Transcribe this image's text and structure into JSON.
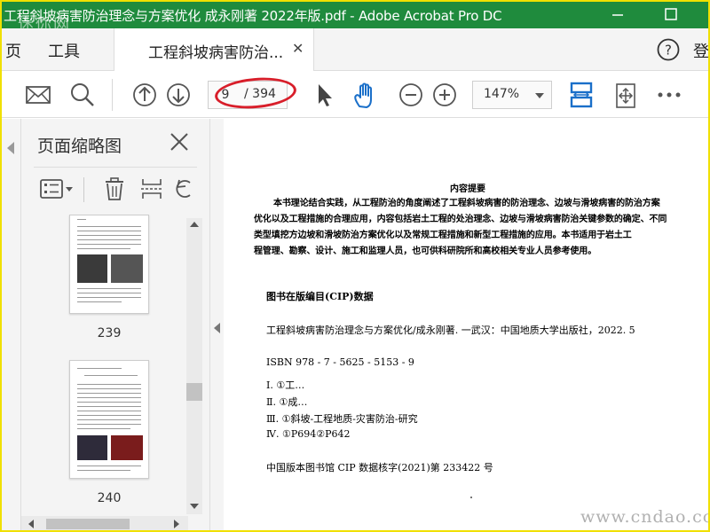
{
  "window": {
    "title": "工程斜坡病害防治理念与方案优化 成永刚著 2022年版.pdf - Adobe Acrobat Pro DC"
  },
  "menubar": {
    "items": [
      "页",
      "工具"
    ],
    "doc_tab_label": "工程斜坡病害防治...",
    "signin_partial": "登"
  },
  "toolbar": {
    "page_current": "9",
    "page_total": "/ 394",
    "zoom": "147%"
  },
  "thumbnails_panel": {
    "title": "页面缩略图",
    "pages": [
      {
        "label": "239"
      },
      {
        "label": "240"
      }
    ]
  },
  "document": {
    "abstract_title": "内容提要",
    "abstract_lines": [
      "本书理论结合实践，从工程防治的角度阐述了工程斜坡病害的防治理念、边坡与滑坡病害的防治方案",
      "优化以及工程措施的合理应用，内容包括岩土工程的处治理念、边坡与滑坡病害防治关键参数的确定、不同",
      "类型填挖方边坡和滑坡防治方案优化以及常规工程措施和新型工程措施的应用。本书适用于岩土工",
      "程管理、勘察、设计、施工和监理人员，也可供科研院所和高校相关专业人员参考使用。"
    ],
    "cip_title": "图书在版编目(CIP)数据",
    "cip_record": "工程斜坡病害防治理念与方案优化/成永刚著. 一武汉：中国地质大学出版社，2022. 5",
    "isbn": "ISBN 978 - 7 - 5625 - 5153 - 9",
    "subjects": [
      "Ⅰ. ①工…",
      "Ⅱ. ①成…",
      "Ⅲ. ①斜坡-工程地质-灾害防治-研究",
      "Ⅳ. ①P694②P642"
    ],
    "cip_number": "中国版本图书馆 CIP 数据核字(2021)第 233422 号"
  },
  "watermarks": {
    "top": "迷你网",
    "bottom": "www.cndao.com"
  },
  "colors": {
    "titlebar": "#1f8b3d",
    "accent_blue": "#1a6fc9",
    "annotation_red": "#d81e2a"
  }
}
